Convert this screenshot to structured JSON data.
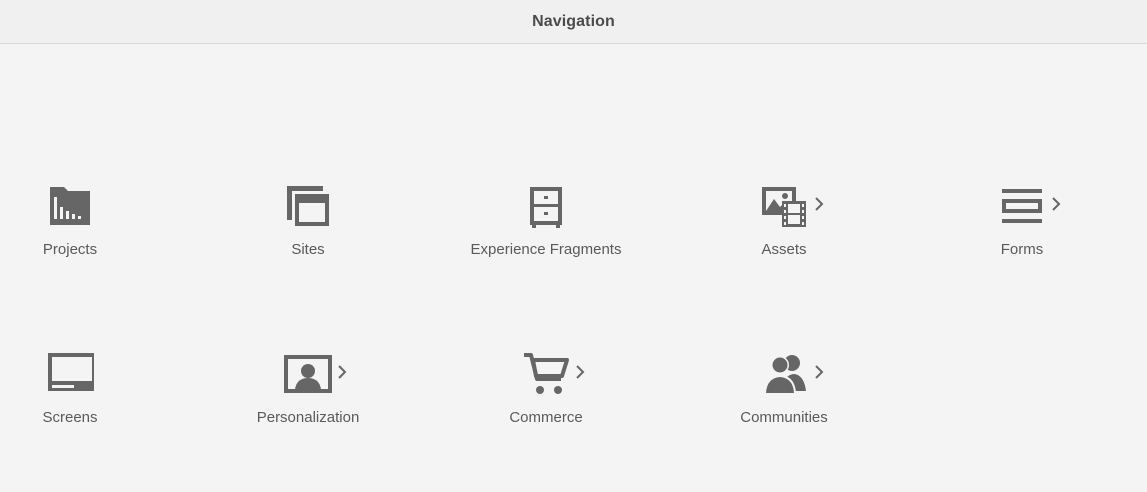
{
  "header": {
    "title": "Navigation"
  },
  "tiles": [
    {
      "label": "Projects",
      "icon": "projects-icon",
      "has_children": false
    },
    {
      "label": "Sites",
      "icon": "sites-icon",
      "has_children": false
    },
    {
      "label": "Experience Fragments",
      "icon": "experience-fragments-icon",
      "has_children": false
    },
    {
      "label": "Assets",
      "icon": "assets-icon",
      "has_children": true
    },
    {
      "label": "Forms",
      "icon": "forms-icon",
      "has_children": true
    },
    {
      "label": "Screens",
      "icon": "screens-icon",
      "has_children": false
    },
    {
      "label": "Personalization",
      "icon": "personalization-icon",
      "has_children": true
    },
    {
      "label": "Commerce",
      "icon": "commerce-icon",
      "has_children": true
    },
    {
      "label": "Communities",
      "icon": "communities-icon",
      "has_children": true
    }
  ],
  "colors": {
    "icon": "#666666",
    "label": "#5a5a5a",
    "background": "#f4f4f4",
    "header_bg": "#f0f0f0"
  }
}
